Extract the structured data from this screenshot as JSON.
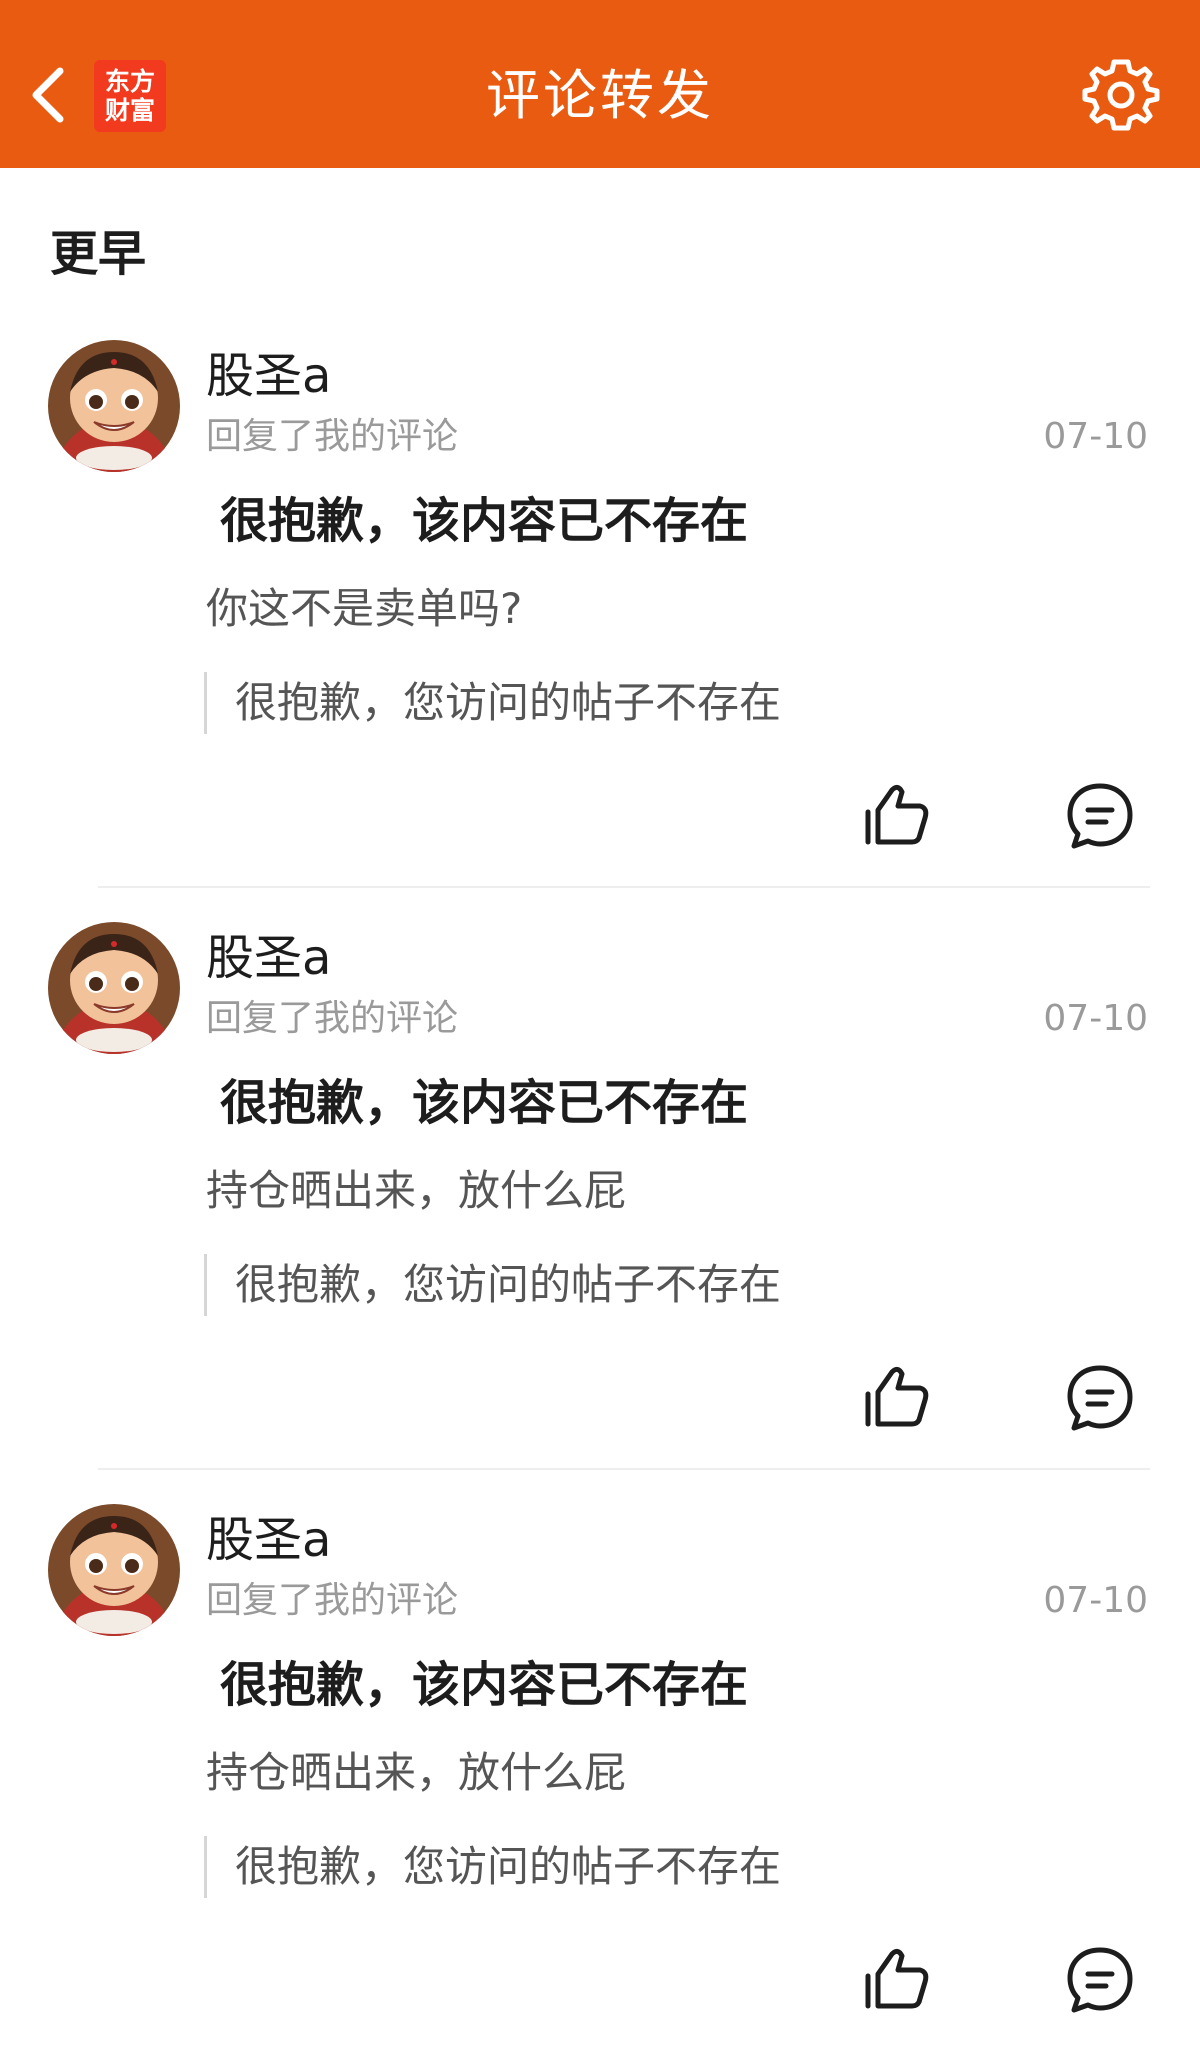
{
  "header": {
    "logo_line1": "东方",
    "logo_line2": "财富",
    "title": "评论转发"
  },
  "section": {
    "title": "更早"
  },
  "items": [
    {
      "username": "股圣a",
      "action": "回复了我的评论",
      "date": "07-10",
      "original": "很抱歉，该内容已不存在",
      "reply": "你这不是卖单吗?",
      "quote": "很抱歉，您访问的帖子不存在"
    },
    {
      "username": "股圣a",
      "action": "回复了我的评论",
      "date": "07-10",
      "original": "很抱歉，该内容已不存在",
      "reply": "持仓晒出来，放什么屁",
      "quote": "很抱歉，您访问的帖子不存在"
    },
    {
      "username": "股圣a",
      "action": "回复了我的评论",
      "date": "07-10",
      "original": "很抱歉，该内容已不存在",
      "reply": "持仓晒出来，放什么屁",
      "quote": "很抱歉，您访问的帖子不存在"
    }
  ],
  "icons": {
    "back": "chevron-left-icon",
    "settings": "gear-icon",
    "like": "thumbs-up-icon",
    "comment": "chat-bubble-icon"
  },
  "colors": {
    "header_bg": "#e95b10",
    "logo_bg": "#f23a1f"
  }
}
